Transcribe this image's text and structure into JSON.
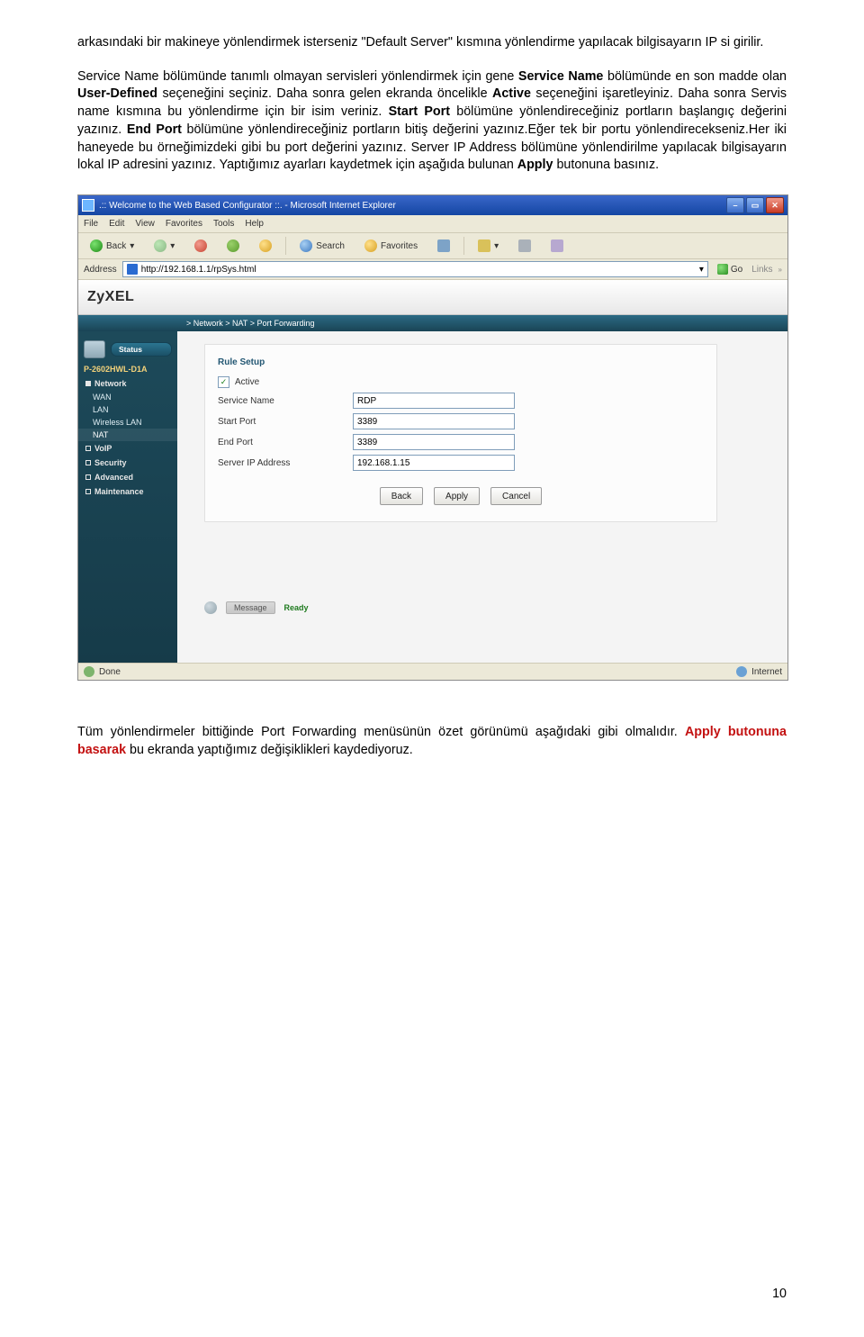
{
  "para1": {
    "t0": "arkasındaki bir makineye yönlendirmek isterseniz \"Default Server\" kısmına yönlendirme yapılacak bilgisayarın IP si girilir."
  },
  "para2": {
    "pre1": "Service Name bölümünde tanımlı olmayan servisleri yönlendirmek için gene ",
    "b1": "Service Name",
    "mid1": " bölümünde en son madde olan ",
    "b2": "User-Defined",
    "mid2": " seçeneğini seçiniz. Daha sonra gelen ekranda  öncelikle  ",
    "b3": "Active",
    "mid3": " seçeneğini işaretleyiniz. Daha sonra Servis name kısmına bu yönlendirme için bir isim veriniz. ",
    "b4": "Start Port",
    "mid4": "   bölümüne yönlendireceğiniz portların başlangıç değerini yazınız. ",
    "b5": "End Port",
    "mid5": "  bölümüne yönlendireceğiniz portların bitiş değerini yazınız.Eğer tek bir portu yönlendirecekseniz.Her iki haneyede bu örneğimizdeki gibi bu port değerini yazınız. Server IP Address  bölümüne yönlendirilme yapılacak bilgisayarın lokal IP adresini yazınız. Yaptığımız ayarları kaydetmek için aşağıda bulunan ",
    "b6": "Apply",
    "end": " butonuna basınız."
  },
  "para3": {
    "pre": "Tüm yönlendirmeler bittiğinde  Port Forwarding menüsünün özet görünümü aşağıdaki gibi olmalıdır. ",
    "red": "Apply butonuna basarak",
    "post": " bu ekranda yaptığımız değişiklikleri kaydediyoruz."
  },
  "page_number": "10",
  "ie": {
    "title": ".:: Welcome to the Web Based Configurator ::. - Microsoft Internet Explorer",
    "menus": [
      "File",
      "Edit",
      "View",
      "Favorites",
      "Tools",
      "Help"
    ],
    "toolbar": {
      "back": "Back",
      "search": "Search",
      "favorites": "Favorites"
    },
    "address_label": "Address",
    "url": "http://192.168.1.1/rpSys.html",
    "go": "Go",
    "links": "Links",
    "status_done": "Done",
    "status_zone": "Internet"
  },
  "app": {
    "logo": "ZyXEL",
    "breadcrumb": "> Network > NAT > Port Forwarding",
    "sidebar": {
      "status": "Status",
      "model": "P-2602HWL-D1A",
      "items": [
        {
          "label": "Network",
          "expanded": true,
          "children": [
            {
              "label": "WAN"
            },
            {
              "label": "LAN"
            },
            {
              "label": "Wireless LAN"
            },
            {
              "label": "NAT",
              "active": true
            }
          ]
        },
        {
          "label": "VoIP"
        },
        {
          "label": "Security"
        },
        {
          "label": "Advanced"
        },
        {
          "label": "Maintenance"
        }
      ]
    },
    "panel": {
      "title": "Rule Setup",
      "active_label": "Active",
      "fields": {
        "service_name": {
          "label": "Service Name",
          "value": "RDP"
        },
        "start_port": {
          "label": "Start Port",
          "value": "3389"
        },
        "end_port": {
          "label": "End Port",
          "value": "3389"
        },
        "server_ip": {
          "label": "Server IP Address",
          "value": "192.168.1.15"
        }
      },
      "buttons": {
        "back": "Back",
        "apply": "Apply",
        "cancel": "Cancel"
      }
    },
    "message": {
      "label": "Message",
      "status": "Ready"
    }
  }
}
